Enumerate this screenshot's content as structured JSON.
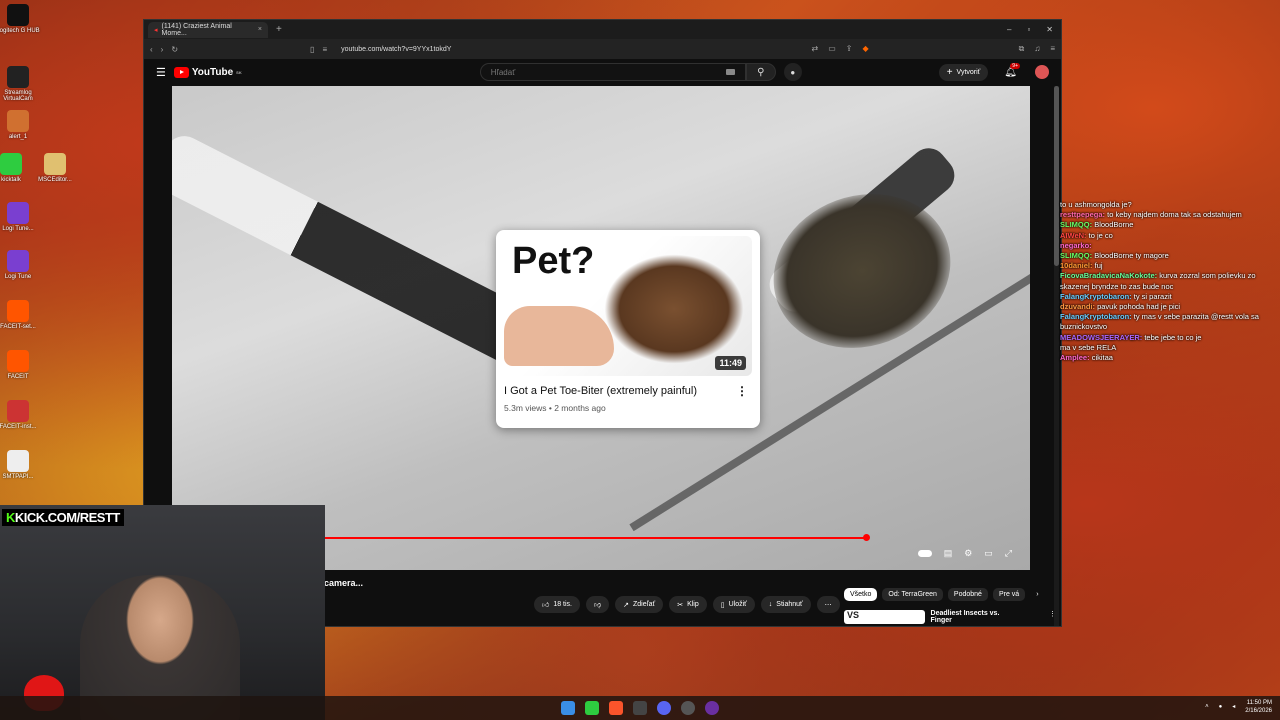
{
  "desktop": {
    "icons": [
      {
        "label": "Logitech G HUB",
        "color": "#111111"
      },
      {
        "label": "Streamlog VirtualCam",
        "color": "#222222"
      },
      {
        "label": "alert_1",
        "color": "#d07030"
      },
      {
        "label": "kicktalk",
        "color": "#2ecc40"
      },
      {
        "label": "MSCEditor...",
        "color": "#e0c070"
      },
      {
        "label": "Logi Tune...",
        "color": "#7a3fd0"
      },
      {
        "label": "Logi Tune",
        "color": "#7a3fd0"
      },
      {
        "label": "FACEIT-set...",
        "color": "#ff5500"
      },
      {
        "label": "FACEIT",
        "color": "#ff5500"
      },
      {
        "label": "FACEIT-inst...",
        "color": "#cc3333"
      },
      {
        "label": "SMTPAPI...",
        "color": "#eeeeee"
      }
    ]
  },
  "browser": {
    "tab_title": "(1141) Craziest Animal Mome...",
    "url": "youtube.com/watch?v=9YYx1tokdY"
  },
  "youtube": {
    "logo_text": "YouTube",
    "country": "SK",
    "search_placeholder": "Hľadať",
    "create_label": "Vytvoriť",
    "notif_count": "9+"
  },
  "endcard": {
    "thumb_text": "Pet?",
    "duration": "11:49",
    "title": "I Got a Pet Toe-Biter (extremely painful)",
    "meta": "5.3m views • 2 months ago"
  },
  "progress_fraction": 0.81,
  "below": {
    "title_fragment": "camera...",
    "actions": [
      "18 tis.",
      "",
      "Zdieľať",
      "Klip",
      "Uložiť",
      "Stiahnuť",
      "⋯"
    ],
    "chips": [
      "Všetko",
      "Od: TerraGreen",
      "Podobné",
      "Pre vá"
    ],
    "rec_title": "Deadliest Insects vs. Finger",
    "rec_thumb_text": "VS"
  },
  "chat": [
    {
      "user": "",
      "color": "#ff5555",
      "text": "to u ashmongolda je?"
    },
    {
      "user": "resttpepega:",
      "color": "#ff66aa",
      "text": "to keby najdem doma tak sa odstahujem"
    },
    {
      "user": "SLIMQQ:",
      "color": "#66ff66",
      "text": "BloodBorne"
    },
    {
      "user": "AIWeN:",
      "color": "#ff4444",
      "text": "to je co"
    },
    {
      "user": "",
      "color": "#ff4444",
      "text": ""
    },
    {
      "user": "negarko:",
      "color": "#ff66cc",
      "text": ""
    },
    {
      "user": "SLIMQQ:",
      "color": "#66ff66",
      "text": "BloodBorne ty magore"
    },
    {
      "user": "10daniel:",
      "color": "#ff9933",
      "text": "fuj"
    },
    {
      "user": "FicovaBradavicaNaKokote:",
      "color": "#66ff99",
      "text": "kurva zozral som polievku zo skazenej bryndze to zas bude noc"
    },
    {
      "user": "FalangKryptobaron:",
      "color": "#66ccff",
      "text": "ty si parazit"
    },
    {
      "user": "dzuvandi:",
      "color": "#ff9944",
      "text": "pavuk pohoda had je pici"
    },
    {
      "user": "FalangKryptobaron:",
      "color": "#66ccff",
      "text": "ty mas v sebe parazita @restt vola sa buznickovstvo"
    },
    {
      "user": "MEADOWSJEERAYER:",
      "color": "#aa66ff",
      "text": "tebe jebe to co je"
    },
    {
      "user": "",
      "color": "#ff5555",
      "text": "ma v sebe RELA"
    },
    {
      "user": "Amplee:",
      "color": "#ff66cc",
      "text": "cikitaa"
    }
  ],
  "webcam": {
    "brand_prefix": "K",
    "brand_text": "KICK.COM/RESTT"
  },
  "tray": {
    "time": "11:50 PM",
    "date": "2/16/2026"
  }
}
